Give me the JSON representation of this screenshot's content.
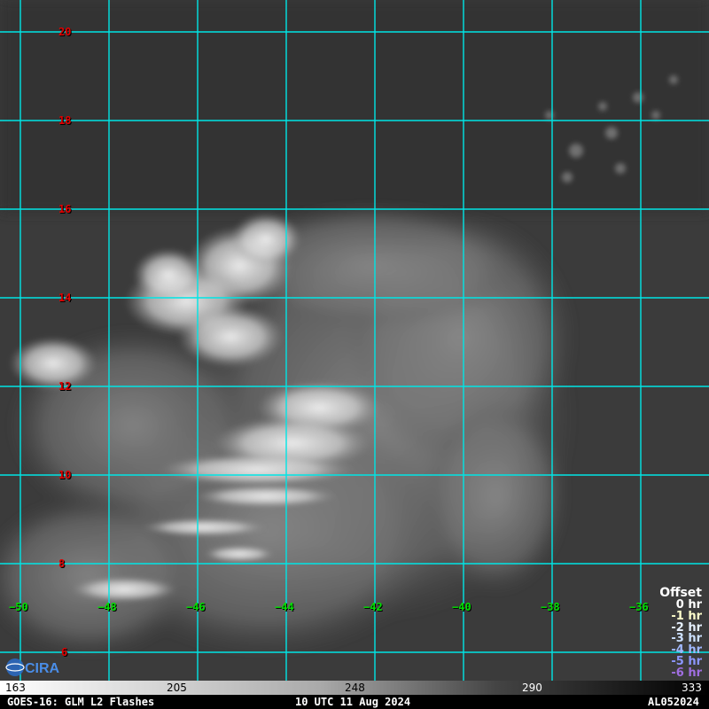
{
  "map": {
    "lat_labels": [
      "20",
      "18",
      "16",
      "14",
      "12",
      "10",
      "8",
      "6"
    ],
    "lon_labels": [
      "−50",
      "−48",
      "−46",
      "−44",
      "−42",
      "−40",
      "−38",
      "−36"
    ],
    "grid_color": "#00e5e5",
    "lat_color": "#e00000",
    "lon_color": "#00e000"
  },
  "legend": {
    "title": "Offset",
    "items": [
      {
        "label": "0 hr",
        "color": "#ffffff"
      },
      {
        "label": "-1 hr",
        "color": "#ffffcc"
      },
      {
        "label": "-2 hr",
        "color": "#e6f0ff"
      },
      {
        "label": "-3 hr",
        "color": "#cce0ff"
      },
      {
        "label": "-4 hr",
        "color": "#a0b8ff"
      },
      {
        "label": "-5 hr",
        "color": "#8c96ff"
      },
      {
        "label": "-6 hr",
        "color": "#a06ee0"
      }
    ]
  },
  "colorbar": {
    "ticks": [
      "163",
      "205",
      "248",
      "290",
      "333"
    ]
  },
  "footer": {
    "left": "GOES-16: GLM L2 Flashes",
    "center": "10 UTC 11 Aug 2024",
    "right": "AL052024"
  },
  "logo": {
    "icon": "cira-logo-icon",
    "text": "CIRA"
  }
}
